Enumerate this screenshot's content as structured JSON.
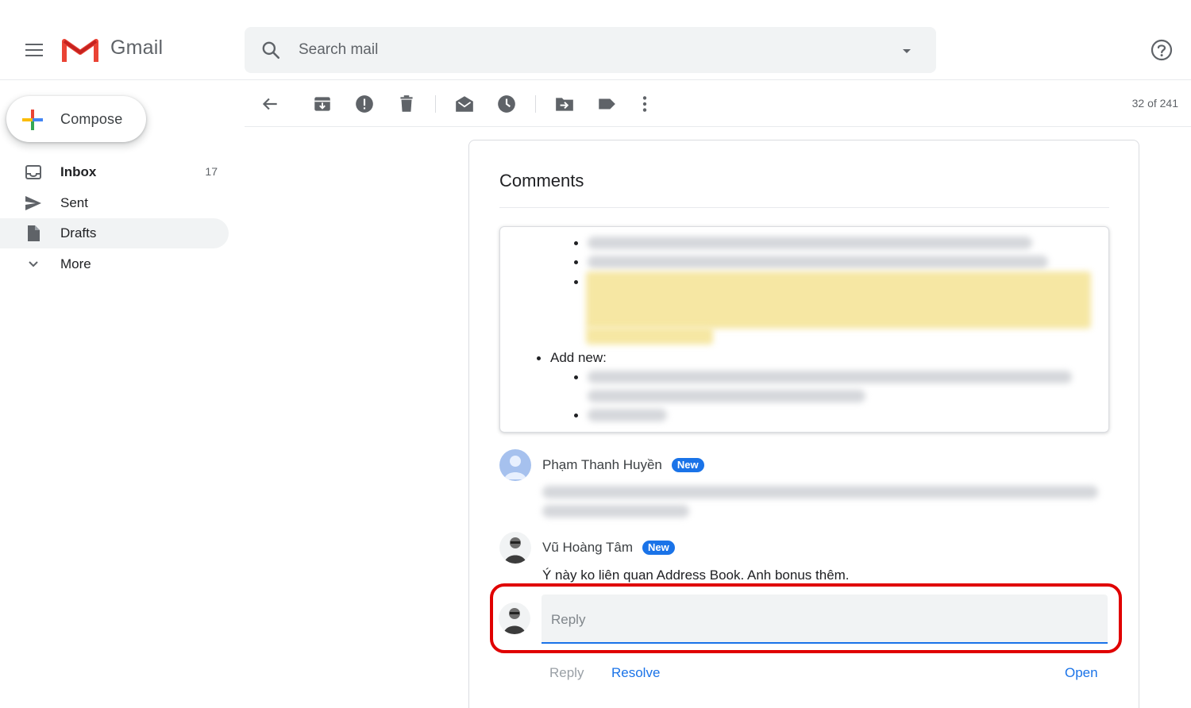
{
  "app": {
    "logo_text": "Gmail"
  },
  "search": {
    "placeholder": "Search mail"
  },
  "sidebar": {
    "compose_label": "Compose",
    "items": [
      {
        "label": "Inbox",
        "count": "17",
        "icon": "inbox-icon"
      },
      {
        "label": "Sent",
        "count": "",
        "icon": "send-icon"
      },
      {
        "label": "Drafts",
        "count": "",
        "icon": "draft-icon"
      },
      {
        "label": "More",
        "count": "",
        "icon": "chevron-down-icon"
      }
    ]
  },
  "toolbar": {
    "icons": [
      "back-arrow-icon",
      "archive-icon",
      "report-spam-icon",
      "delete-icon",
      "mark-unread-icon",
      "snooze-icon",
      "move-to-icon",
      "label-icon",
      "more-vert-icon"
    ],
    "pager": "32 of 241"
  },
  "comments": {
    "title": "Comments",
    "quote_add_new": "Add new:",
    "items": [
      {
        "author": "Phạm Thanh Huyền",
        "badge": "New",
        "text": ""
      },
      {
        "author": "Vũ Hoàng Tâm",
        "badge": "New",
        "text": "Ý này ko liên quan Address Book. Anh bonus thêm."
      }
    ],
    "reply_placeholder": "Reply",
    "actions": {
      "reply": "Reply",
      "resolve": "Resolve",
      "open": "Open"
    }
  },
  "colors": {
    "accent": "#1a73e8",
    "highlight_annotation": "#e00000",
    "gmail_red": "#ea4335"
  }
}
